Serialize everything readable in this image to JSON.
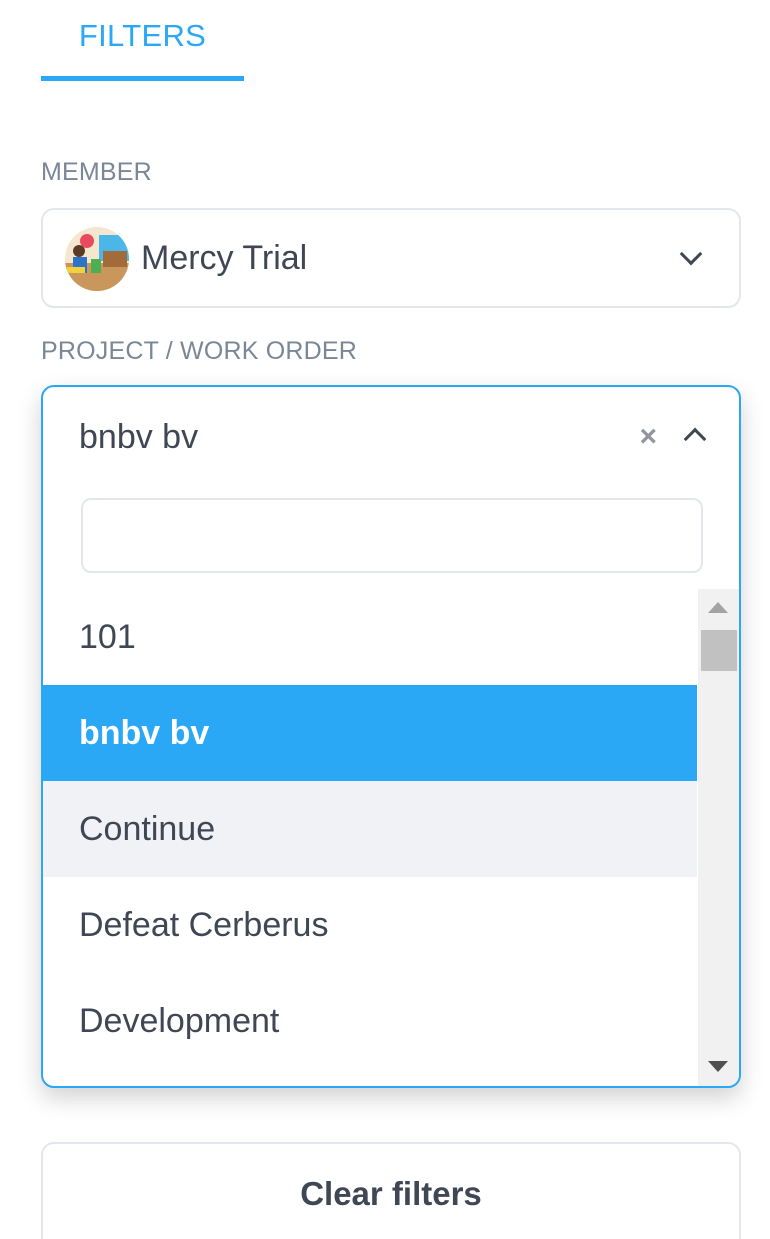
{
  "tabs": {
    "filters_label": "FILTERS"
  },
  "member": {
    "label": "MEMBER",
    "selected_name": "Mercy Trial"
  },
  "project": {
    "label": "PROJECT / WORK ORDER",
    "selected_value": "bnbv bv",
    "clear_glyph": "×",
    "search_placeholder": "",
    "options": [
      {
        "label": "101"
      },
      {
        "label": "bnbv bv"
      },
      {
        "label": "Continue"
      },
      {
        "label": "Defeat Cerberus"
      },
      {
        "label": "Development"
      }
    ]
  },
  "actions": {
    "clear_filters_label": "Clear filters"
  },
  "colors": {
    "accent": "#2aa7f5",
    "selected_option_bg": "#2aa7f5",
    "hover_option_bg": "#f0f2f5",
    "label_gray": "#7a8797",
    "text_dark": "#3f4654"
  }
}
